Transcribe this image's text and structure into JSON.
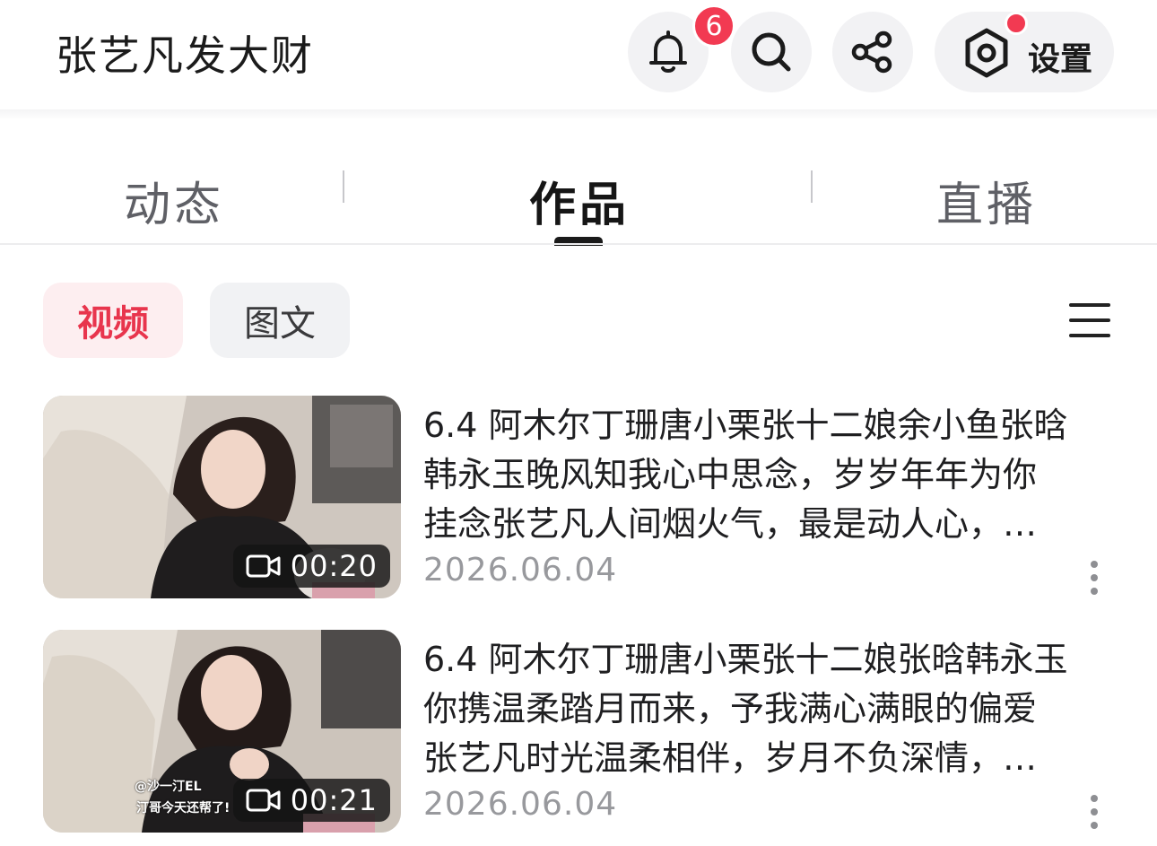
{
  "header": {
    "title": "张艺凡发大财",
    "notification_count": "6",
    "settings_label": "设置",
    "icons": [
      "bell-icon",
      "search-icon",
      "share-icon",
      "settings-icon"
    ]
  },
  "tabs": [
    {
      "label": "动态",
      "active": false
    },
    {
      "label": "作品",
      "active": true
    },
    {
      "label": "直播",
      "active": false
    }
  ],
  "filters": {
    "video_label": "视频",
    "image_text_label": "图文",
    "selected": "视频"
  },
  "items": [
    {
      "lines": [
        "6.4 阿木尔丁珊唐小栗张十二娘余小鱼张晗",
        "韩永玉晚风知我心中思念，岁岁年年为你",
        "挂念张艺凡人间烟火气，最是动人心，…"
      ],
      "date": "2026.06.04",
      "duration": "00:20",
      "watermark": ""
    },
    {
      "lines": [
        "6.4 阿木尔丁珊唐小栗张十二娘张晗韩永玉",
        "你携温柔踏月而来，予我满心满眼的偏爱",
        "张艺凡时光温柔相伴，岁月不负深情，…"
      ],
      "date": "2026.06.04",
      "duration": "00:21",
      "watermark_top": "@沙一汀EL",
      "watermark_bottom": "汀哥今天还帮了!"
    }
  ],
  "colors": {
    "accent": "#f23a52",
    "chip_active_bg": "#fdeef0",
    "chip_active_text": "#e8354d",
    "chip_bg": "#f1f2f4",
    "date_text": "#98999d"
  }
}
